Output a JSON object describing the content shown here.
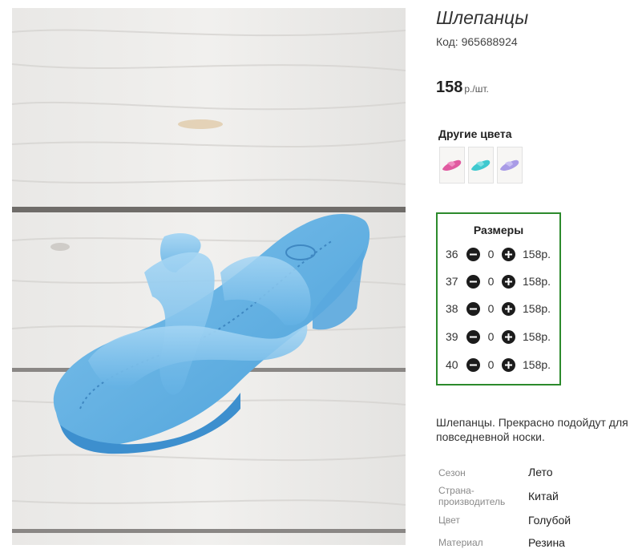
{
  "product": {
    "title": "Шлепанцы",
    "code_label": "Код:",
    "code_value": "965688924",
    "price_amount": "158",
    "price_unit": "р./шт.",
    "photo_icon": "blue-wedge-sandal-photo"
  },
  "other_colors": {
    "title": "Другие цвета",
    "swatches": [
      {
        "icon": "pink-sandal-thumb",
        "color": "#e05aa0"
      },
      {
        "icon": "turquoise-sandal-thumb",
        "color": "#3fc9cf"
      },
      {
        "icon": "lilac-sandal-thumb",
        "color": "#a99be6"
      }
    ]
  },
  "sizes": {
    "title": "Размеры",
    "minus_icon": "minus-circle-icon",
    "plus_icon": "plus-circle-icon",
    "border_color": "#2c8a2c",
    "rows": [
      {
        "size": "36",
        "qty": "0",
        "price": "158р."
      },
      {
        "size": "37",
        "qty": "0",
        "price": "158р."
      },
      {
        "size": "38",
        "qty": "0",
        "price": "158р."
      },
      {
        "size": "39",
        "qty": "0",
        "price": "158р."
      },
      {
        "size": "40",
        "qty": "0",
        "price": "158р."
      }
    ]
  },
  "description": "Шлепанцы. Прекрасно подойдут для повседневной носки.",
  "attributes": [
    {
      "label_lines": [
        "Сезон"
      ],
      "value": "Лето"
    },
    {
      "label_lines": [
        "Страна-",
        "производитель"
      ],
      "value": "Китай"
    },
    {
      "label_lines": [
        "Цвет"
      ],
      "value": "Голубой"
    },
    {
      "label_lines": [
        "Материал"
      ],
      "value": "Резина"
    }
  ]
}
